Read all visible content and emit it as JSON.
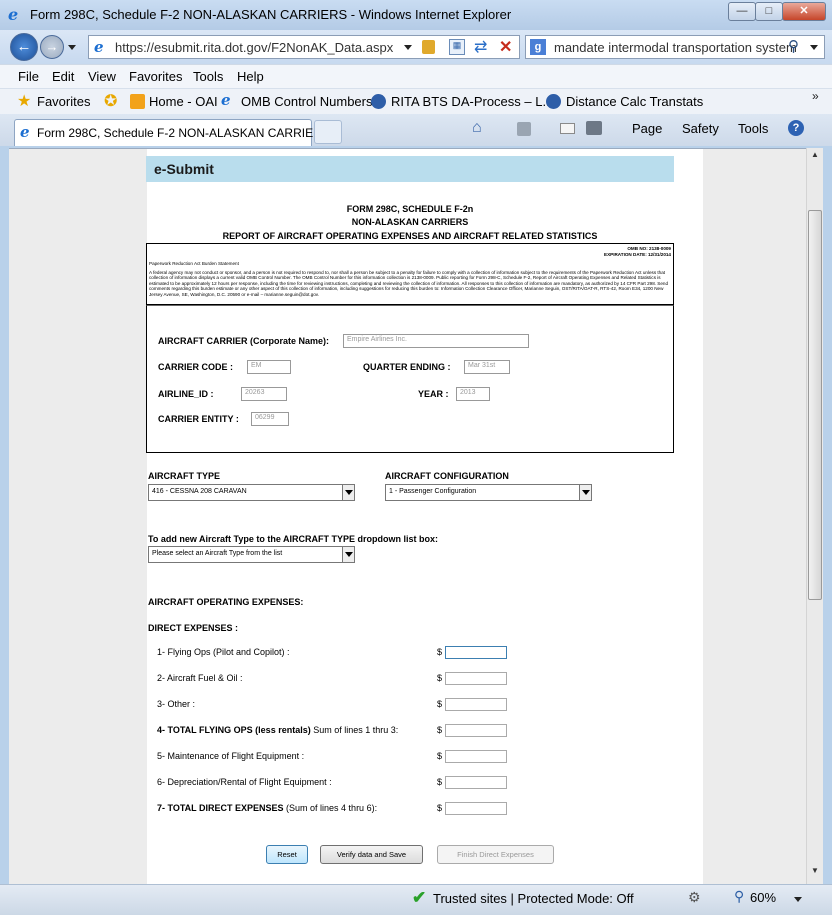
{
  "window": {
    "title": "Form 298C, Schedule F-2 NON-ALASKAN CARRIERS - Windows Internet Explorer"
  },
  "address": {
    "url": "https://esubmit.rita.dot.gov/F2NonAK_Data.aspx"
  },
  "search": {
    "value": "mandate intermodal transportation system"
  },
  "menu": [
    "File",
    "Edit",
    "View",
    "Favorites",
    "Tools",
    "Help"
  ],
  "favorites": {
    "label": "Favorites",
    "items": [
      "Home - OAI",
      "OMB Control Numbers",
      "RITA  BTS  DA-Process – L...",
      "Distance Calc Transtats"
    ]
  },
  "tab": {
    "label": "Form 298C, Schedule F-2 NON-ALASKAN CARRIE..."
  },
  "command": {
    "page": "Page",
    "safety": "Safety",
    "tools": "Tools"
  },
  "header": {
    "brand": "e-Submit"
  },
  "form": {
    "line1": "FORM 298C,  SCHEDULE F-2n",
    "line2": "NON-ALASKAN CARRIERS",
    "line3": "REPORT OF AIRCRAFT OPERATING EXPENSES AND AIRCRAFT RELATED STATISTICS"
  },
  "burden": {
    "omb": "OMB NO: 2138-0009",
    "expiration": "EXPIRATION DATE: 12/31/2014",
    "heading": "Paperwork Reduction Act Burden Statement",
    "text": "A federal agency may not conduct or sponsor, and a person is not required to respond to, nor shall a person be subject to a penalty for failure to comply with a collection of information subject to the requirements of the Paperwork Reduction Act unless that collection of information displays a current valid OMB Control Number. The OMB Control Number for this information collection is 2138-0009. Public reporting for Form 298-C, Schedule F-2, Report of Aircraft Operating Expenses and Related Statistics is estimated to be approximately 12 hours per response, including the time for reviewing instructions, completing and reviewing the collection of information. All responses to this collection of information are mandatory, as authorized by 14 CFR Part 298. Send comments regarding this burden estimate or any other aspect of this collection of information, including suggestions for reducing this burden to: Information Collection Clearance Officer, Marianne Seguin, OST/RITA/OAT-R, RTS-42, Room E34, 1200 New Jersey Avenue, SE, Washington, D.C. 20590 or e-mail – marianne.seguin@dot.gov."
  },
  "carrier": {
    "name_label": "AIRCRAFT CARRIER (Corporate Name):",
    "name_value": "Empire Airlines Inc.",
    "code_label": "CARRIER CODE :",
    "code_value": "EM",
    "quarter_label": "QUARTER ENDING :",
    "quarter_value": "Mar 31st",
    "airline_id_label": "AIRLINE_ID :",
    "airline_id_value": "20263",
    "year_label": "YEAR :",
    "year_value": "2013",
    "entity_label": "CARRIER ENTITY :",
    "entity_value": "06299"
  },
  "aircraft": {
    "type_label": "AIRCRAFT TYPE",
    "type_value": "416 - CESSNA 208 CARAVAN",
    "config_label": "AIRCRAFT CONFIGURATION",
    "config_value": "1 - Passenger Configuration",
    "add_label": "To add new Aircraft Type to the AIRCRAFT TYPE dropdown list box:",
    "add_value": "Please select an Aircraft Type from the list"
  },
  "expenses": {
    "heading": "AIRCRAFT OPERATING EXPENSES:",
    "direct": "DIRECT EXPENSES :",
    "currency": "$",
    "lines": [
      {
        "label": "1- Flying Ops (Pilot and Copilot) :",
        "bold": "",
        "rest": ""
      },
      {
        "label": "2- Aircraft Fuel & Oil :",
        "bold": "",
        "rest": ""
      },
      {
        "label": "3- Other :",
        "bold": "",
        "rest": ""
      },
      {
        "label": "",
        "bold": "4- TOTAL FLYING OPS (less rentals)",
        "rest": " Sum of lines 1 thru 3:"
      },
      {
        "label": "5- Maintenance of Flight Equipment :",
        "bold": "",
        "rest": ""
      },
      {
        "label": "6- Depreciation/Rental of Flight Equipment :",
        "bold": "",
        "rest": ""
      },
      {
        "label": "",
        "bold": "7- TOTAL DIRECT EXPENSES",
        "rest": "  (Sum of lines 4 thru 6):"
      }
    ]
  },
  "buttons": {
    "reset": "Reset",
    "verify": "Verify data and Save",
    "finish": "Finish Direct Expenses"
  },
  "status": {
    "zone": "Trusted sites | Protected Mode: Off",
    "zoom": "60%"
  }
}
